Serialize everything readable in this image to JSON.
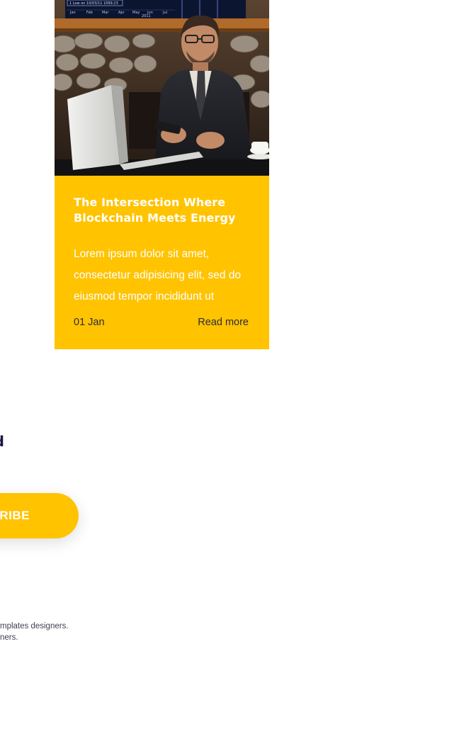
{
  "blog_card": {
    "title": "The Intersection Where Blockchain Meets Energy",
    "excerpt": "Lorem ipsum dolor sit amet, consectetur adipisicing elit, sed do eiusmod tempor incididunt ut",
    "date": "01 Jan",
    "read_more": "Read more",
    "image": "photo-man-with-laptop-and-phone",
    "chart_labels": {
      "low": "1 Low on 10/03/11 1099.23",
      "months": [
        "Jan",
        "Feb",
        "Mar",
        "Apr",
        "May",
        "Jun",
        "Jul"
      ],
      "year": "2011"
    }
  },
  "newsletter": {
    "heading_fragment": "d",
    "subscribe_label": "RIBE"
  },
  "footer": {
    "line1": "mplates designers.",
    "line2": "ners."
  },
  "colors": {
    "accent": "#ffc300",
    "heading_dark": "#1d1545",
    "text_dark": "#2b2b3a"
  }
}
